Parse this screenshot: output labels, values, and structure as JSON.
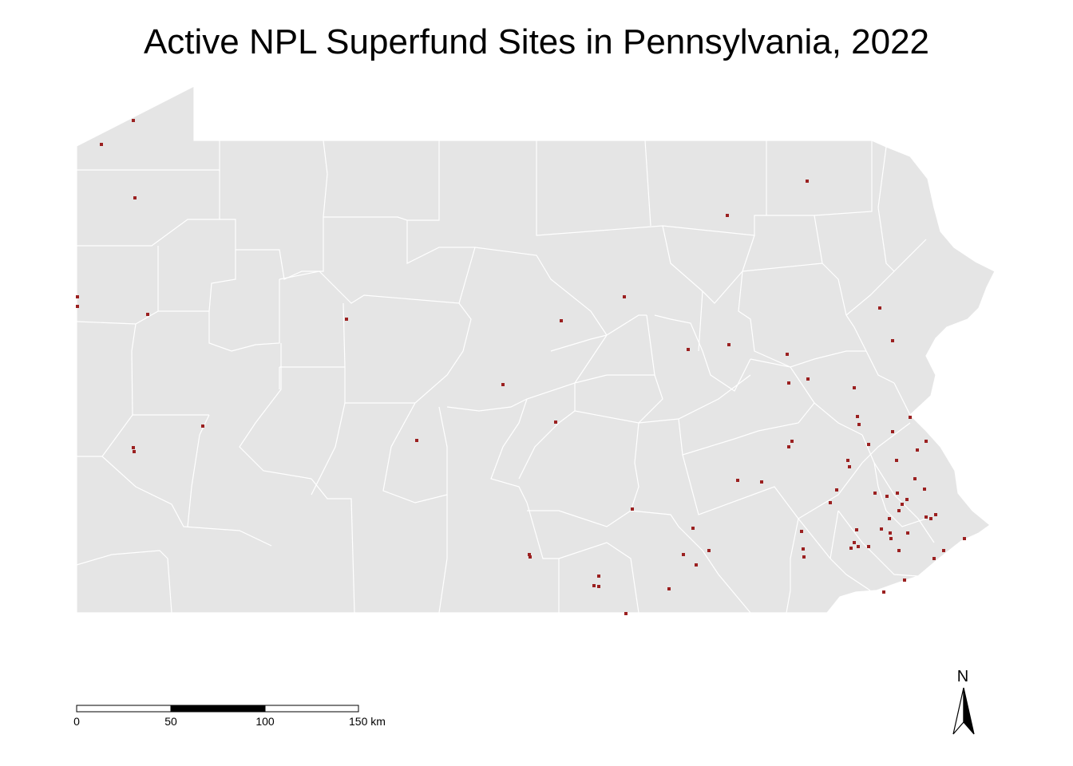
{
  "title": "Active NPL Superfund Sites in Pennsylvania, 2022",
  "colors": {
    "land": "#e5e5e5",
    "borders": "#ffffff",
    "site_marker": "#9b2020",
    "background": "#ffffff"
  },
  "scale_bar": {
    "labels": [
      "0",
      "50",
      "100",
      "150 km"
    ]
  },
  "north_arrow": {
    "label": "N"
  },
  "sites_count": 86
}
